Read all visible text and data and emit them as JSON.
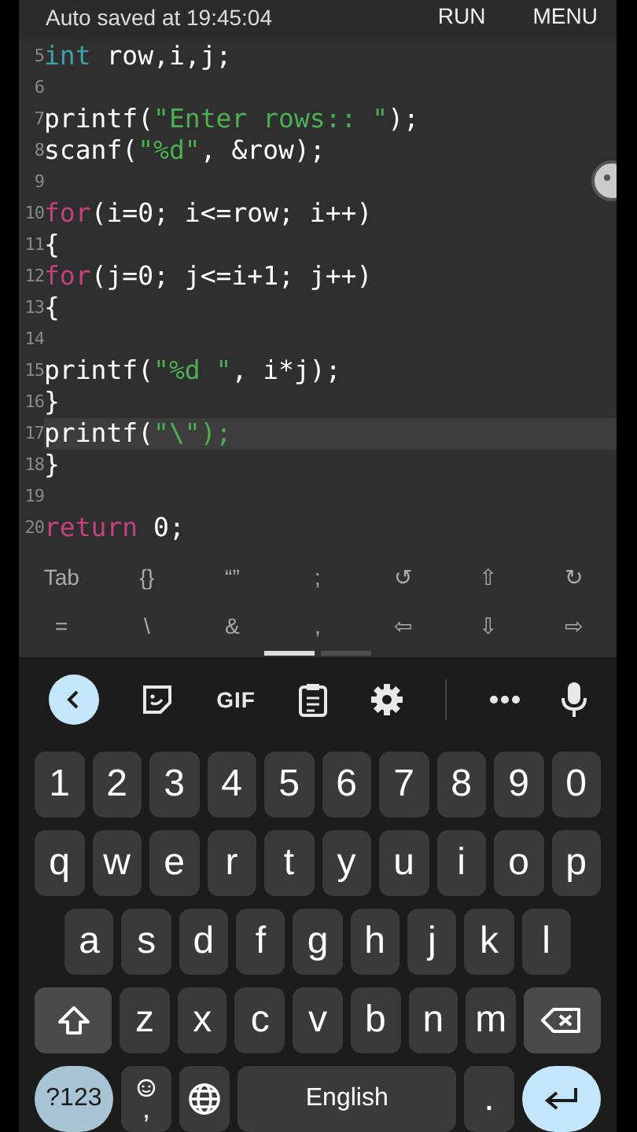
{
  "header": {
    "status": "Auto saved at 19:45:04",
    "actions": [
      "RUN",
      "MENU"
    ]
  },
  "editor": {
    "lines": [
      {
        "number": "5",
        "current": false,
        "tokens": [
          {
            "kind": "type",
            "text": "int"
          },
          {
            "kind": "plain",
            "text": " row,i,j;"
          }
        ]
      },
      {
        "number": "6",
        "current": false
      },
      {
        "number": "7",
        "current": false,
        "tokens": [
          {
            "kind": "plain",
            "text": "printf("
          },
          {
            "kind": "string",
            "text": "\"Enter rows:: \""
          },
          {
            "kind": "plain",
            "text": ");"
          }
        ]
      },
      {
        "number": "8",
        "current": false,
        "tokens": [
          {
            "kind": "plain",
            "text": "scanf("
          },
          {
            "kind": "string",
            "text": "\"%d\""
          },
          {
            "kind": "plain",
            "text": ", &row);"
          }
        ]
      },
      {
        "number": "9",
        "current": false
      },
      {
        "number": "10",
        "current": false,
        "tokens": [
          {
            "kind": "keyword",
            "text": "for"
          },
          {
            "kind": "plain",
            "text": "(i=0; i<=row; i++)"
          }
        ]
      },
      {
        "number": "11",
        "current": false,
        "tokens": [
          {
            "kind": "plain",
            "text": "{"
          }
        ]
      },
      {
        "number": "12",
        "current": false,
        "tokens": [
          {
            "kind": "keyword",
            "text": "for"
          },
          {
            "kind": "plain",
            "text": "(j=0; j<=i+1; j++)"
          }
        ]
      },
      {
        "number": "13",
        "current": false,
        "tokens": [
          {
            "kind": "plain",
            "text": "{"
          }
        ]
      },
      {
        "number": "14",
        "current": false
      },
      {
        "number": "15",
        "current": false,
        "tokens": [
          {
            "kind": "plain",
            "text": "printf("
          },
          {
            "kind": "string",
            "text": "\"%d \""
          },
          {
            "kind": "plain",
            "text": ", i*j);"
          }
        ]
      },
      {
        "number": "16",
        "current": false,
        "tokens": [
          {
            "kind": "plain",
            "text": "}"
          }
        ]
      },
      {
        "number": "17",
        "current": true,
        "tokens": [
          {
            "kind": "plain",
            "text": "printf("
          },
          {
            "kind": "string",
            "text": "\"\\\");"
          }
        ]
      },
      {
        "number": "18",
        "current": false,
        "tokens": [
          {
            "kind": "plain",
            "text": "}"
          }
        ]
      },
      {
        "number": "19",
        "current": false
      },
      {
        "number": "20",
        "current": false,
        "tokens": [
          {
            "kind": "keyword",
            "text": "return"
          },
          {
            "kind": "plain",
            "text": " 0;"
          }
        ]
      }
    ]
  },
  "extra_keys": {
    "rows": [
      [
        "Tab",
        "{}",
        "“”",
        ";",
        "↺",
        "⇧",
        "↻"
      ],
      [
        "=",
        "\\",
        "&",
        ",",
        "⇦",
        "⇩",
        "⇨"
      ]
    ],
    "pages": [
      {
        "selected": true
      },
      {
        "selected": false
      }
    ]
  },
  "keyboard_toolbar": {
    "gif_label": "GIF"
  },
  "keyboard": {
    "rows": [
      [
        {
          "kind": "char",
          "label": "1"
        },
        {
          "kind": "char",
          "label": "2"
        },
        {
          "kind": "char",
          "label": "3"
        },
        {
          "kind": "char",
          "label": "4"
        },
        {
          "kind": "char",
          "label": "5"
        },
        {
          "kind": "char",
          "label": "6"
        },
        {
          "kind": "char",
          "label": "7"
        },
        {
          "kind": "char",
          "label": "8"
        },
        {
          "kind": "char",
          "label": "9"
        },
        {
          "kind": "char",
          "label": "0"
        }
      ],
      [
        {
          "kind": "char",
          "label": "q"
        },
        {
          "kind": "char",
          "label": "w"
        },
        {
          "kind": "char",
          "label": "e"
        },
        {
          "kind": "char",
          "label": "r"
        },
        {
          "kind": "char",
          "label": "t"
        },
        {
          "kind": "char",
          "label": "y"
        },
        {
          "kind": "char",
          "label": "u"
        },
        {
          "kind": "char",
          "label": "i"
        },
        {
          "kind": "char",
          "label": "o"
        },
        {
          "kind": "char",
          "label": "p"
        }
      ],
      [
        {
          "kind": "char",
          "label": "a"
        },
        {
          "kind": "char",
          "label": "s"
        },
        {
          "kind": "char",
          "label": "d"
        },
        {
          "kind": "char",
          "label": "f"
        },
        {
          "kind": "char",
          "label": "g"
        },
        {
          "kind": "char",
          "label": "h"
        },
        {
          "kind": "char",
          "label": "j"
        },
        {
          "kind": "char",
          "label": "k"
        },
        {
          "kind": "char",
          "label": "l"
        }
      ],
      [
        {
          "kind": "shift"
        },
        {
          "kind": "char",
          "label": "z"
        },
        {
          "kind": "char",
          "label": "x"
        },
        {
          "kind": "char",
          "label": "c"
        },
        {
          "kind": "char",
          "label": "v"
        },
        {
          "kind": "char",
          "label": "b"
        },
        {
          "kind": "char",
          "label": "n"
        },
        {
          "kind": "char",
          "label": "m"
        },
        {
          "kind": "backspace"
        }
      ]
    ],
    "bottom_row": [
      {
        "kind": "symbols",
        "label": "?123"
      },
      {
        "kind": "emoji_comma",
        "label": ","
      },
      {
        "kind": "globe"
      },
      {
        "kind": "space",
        "label": "English"
      },
      {
        "kind": "char",
        "label": "."
      },
      {
        "kind": "enter"
      }
    ]
  }
}
